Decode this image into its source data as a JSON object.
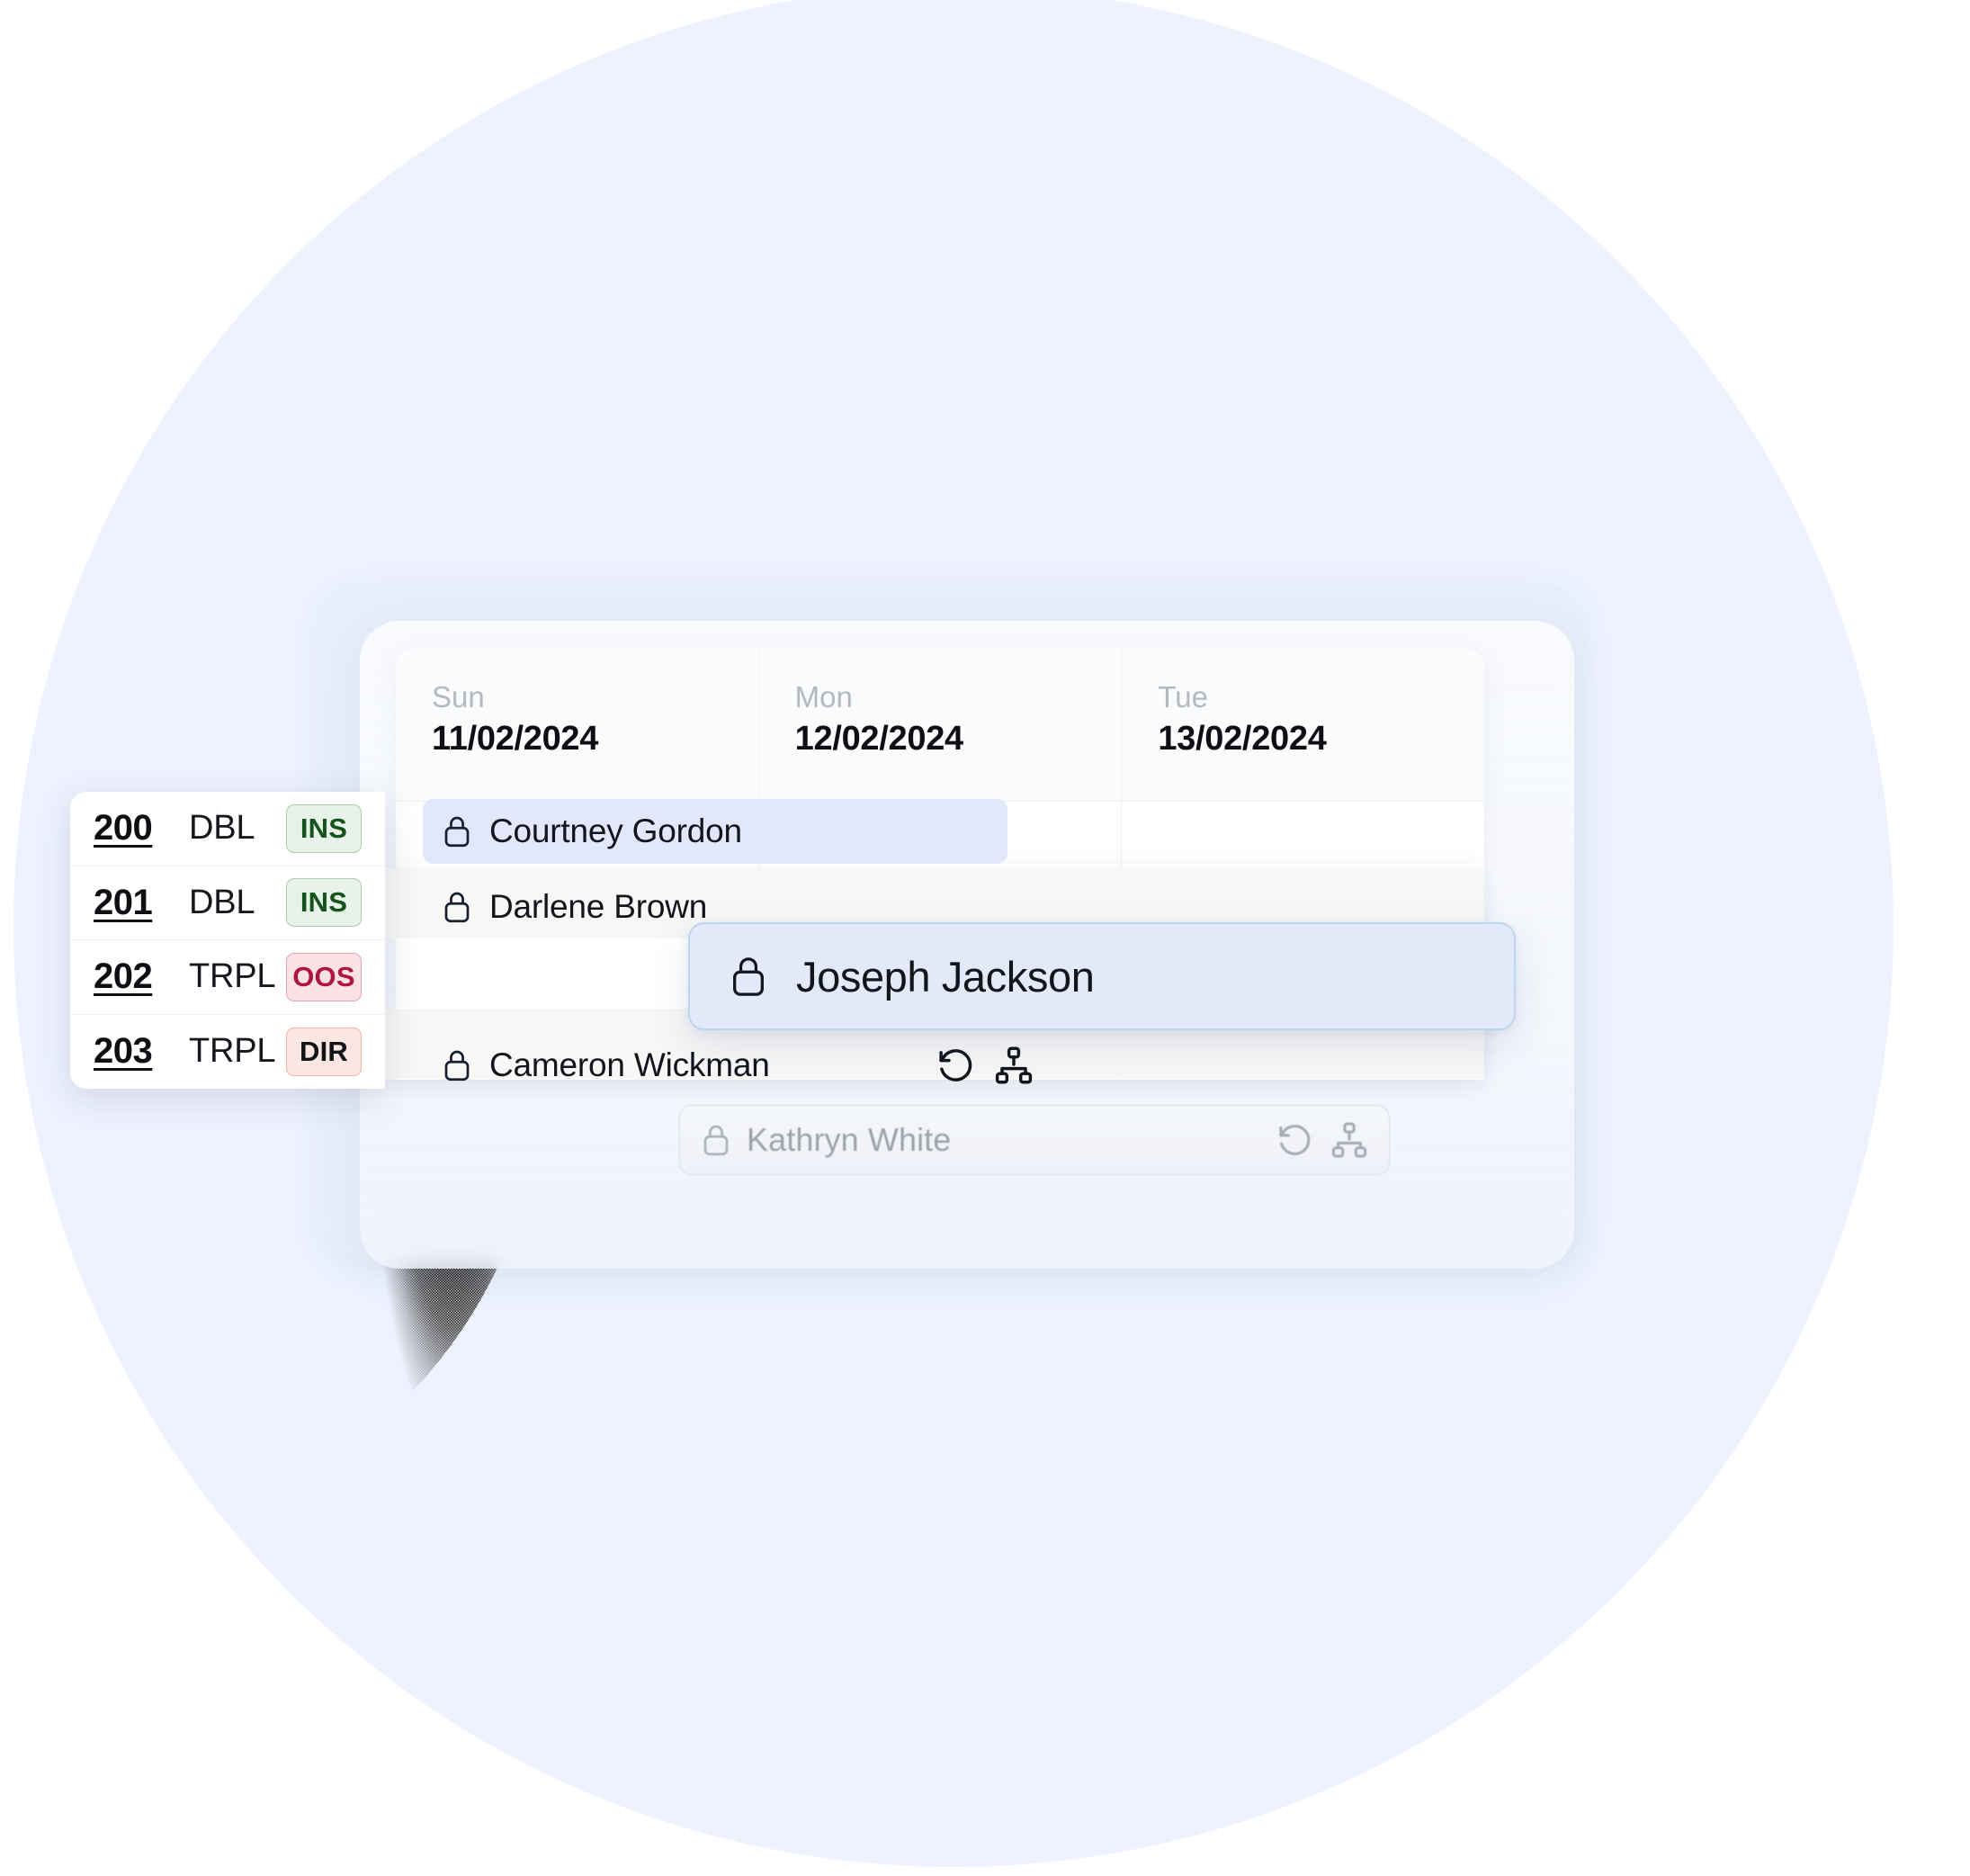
{
  "calendar": {
    "columns": [
      {
        "day": "Sun",
        "date": "11/02/2024"
      },
      {
        "day": "Mon",
        "date": "12/02/2024"
      },
      {
        "day": "Tue",
        "date": "13/02/2024"
      }
    ]
  },
  "rooms": [
    {
      "number": "200",
      "type": "DBL",
      "status": "INS",
      "status_kind": "ins"
    },
    {
      "number": "201",
      "type": "DBL",
      "status": "INS",
      "status_kind": "ins"
    },
    {
      "number": "202",
      "type": "TRPL",
      "status": "OOS",
      "status_kind": "oos"
    },
    {
      "number": "203",
      "type": "TRPL",
      "status": "DIR",
      "status_kind": "dir"
    }
  ],
  "bookings": [
    {
      "guest": "Courtney Gordon",
      "locked": true,
      "highlighted": true
    },
    {
      "guest": "Darlene Brown",
      "locked": true,
      "highlighted": false
    },
    {
      "guest": "Cameron Wickman",
      "locked": true,
      "highlighted": false
    }
  ],
  "dragged_booking": {
    "guest": "Joseph Jackson",
    "locked": true
  },
  "ghost_booking": {
    "guest": "Kathryn White",
    "locked": true
  },
  "icons": {
    "lock": "lock-icon",
    "restore": "restore-history-icon",
    "hierarchy": "hierarchy-icon"
  },
  "colors": {
    "background_circle": "#edf2fe",
    "base_card": "#e7edf9",
    "highlight_bar": "#e2e7fb",
    "float_card_bg": "#e2eaf9",
    "float_card_border": "#bed5ee",
    "badge_ins_bg": "#e7f2e8",
    "badge_ins_text": "#14531b",
    "badge_oos_bg": "#fae2e7",
    "badge_oos_text": "#b01440",
    "badge_dir_bg": "#fbe6e1",
    "badge_dir_text": "#121417",
    "day_label": "#b4b8bf",
    "date_text": "#0d0f12"
  }
}
